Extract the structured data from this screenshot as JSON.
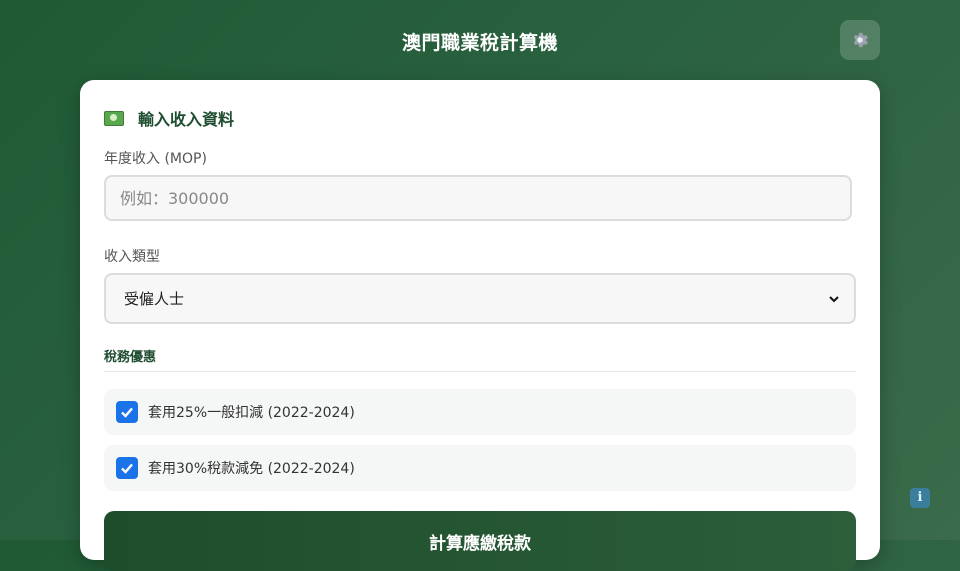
{
  "header": {
    "title": "澳門職業稅計算機",
    "settings_icon": "gear-icon"
  },
  "form": {
    "section_title": "輸入收入資料",
    "section_icon": "money-icon",
    "income_label": "年度收入 (MOP)",
    "income_placeholder": "例如：300000",
    "income_value": "",
    "type_label": "收入類型",
    "type_selected": "受僱人士",
    "discounts_title": "稅務優惠",
    "discounts": [
      {
        "label": "套用25%一般扣減 (2022-2024)",
        "checked": true
      },
      {
        "label": "套用30%稅款減免 (2022-2024)",
        "checked": true
      }
    ],
    "submit_label": "計算應繳稅款"
  },
  "info_button": {
    "label": "i",
    "icon": "info-icon"
  },
  "colors": {
    "background": "#2a6140",
    "accent": "#1a73e8",
    "heading": "#1e4d30",
    "button": "#1e4d2b"
  }
}
